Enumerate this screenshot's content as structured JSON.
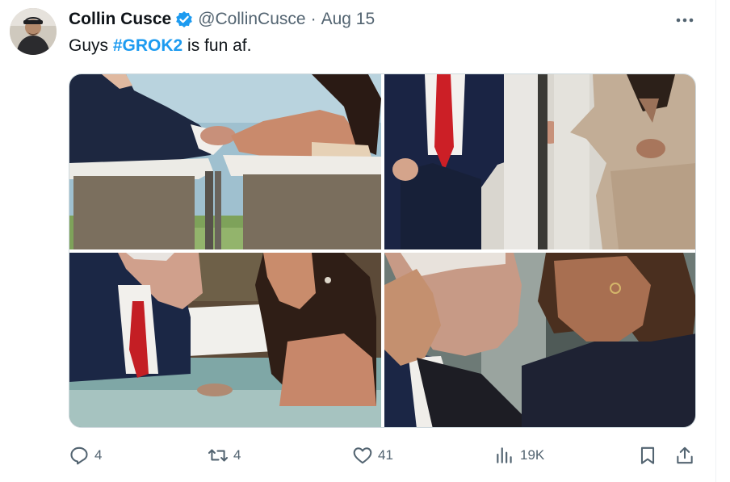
{
  "tweet": {
    "author": {
      "display_name": "Collin Cusce",
      "handle": "@CollinCusce",
      "verified": true,
      "avatar_icon": "user-avatar"
    },
    "separator": "·",
    "date": "Aug 15",
    "text_prefix": "Guys ",
    "hashtag": "#GROK2",
    "text_suffix": " is fun af.",
    "more_icon": "more-horizontal-icon"
  },
  "media": {
    "images": [
      {
        "name": "media-image-1",
        "subject": "two people holding hands seated in white bathtubs by a lake"
      },
      {
        "name": "media-image-2",
        "subject": "man in suit and woman in beige suit holding hands between bathtubs"
      },
      {
        "name": "media-image-3",
        "subject": "man in suit and woman sitting in water of a bathtub"
      },
      {
        "name": "media-image-4",
        "subject": "woman touching the face of an older man"
      }
    ]
  },
  "actions": {
    "reply": {
      "icon": "reply-icon",
      "count": "4"
    },
    "repost": {
      "icon": "repost-icon",
      "count": "4"
    },
    "like": {
      "icon": "heart-icon",
      "count": "41"
    },
    "views": {
      "icon": "views-icon",
      "count": "19K"
    },
    "bookmark": {
      "icon": "bookmark-icon"
    },
    "share": {
      "icon": "share-icon"
    }
  },
  "colors": {
    "accent": "#1d9bf0",
    "text": "#0f1419",
    "muted": "#536471",
    "border": "#cfd9de"
  }
}
